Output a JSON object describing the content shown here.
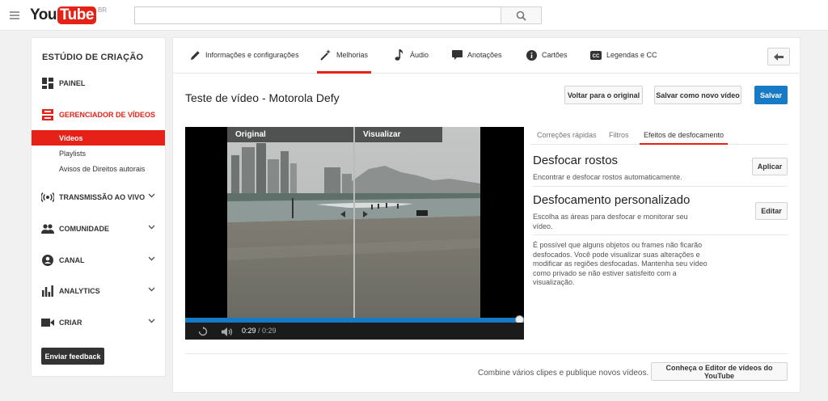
{
  "masthead": {
    "logo_you": "You",
    "logo_tube": "Tube",
    "logo_region": "BR",
    "search_placeholder": "",
    "icons": {
      "menu": "menu-icon",
      "search": "search-icon"
    }
  },
  "sidebar": {
    "heading": "ESTÚDIO DE CRIAÇÃO",
    "items": [
      {
        "label": "PAINEL",
        "icon": "dashboard-icon"
      },
      {
        "label": "GERENCIADOR DE VÍDEOS",
        "icon": "video-manager-icon",
        "active": true
      },
      {
        "label": "TRANSMISSÃO AO VIVO",
        "icon": "live-icon"
      },
      {
        "label": "COMUNIDADE",
        "icon": "community-icon"
      },
      {
        "label": "CANAL",
        "icon": "channel-icon"
      },
      {
        "label": "ANALYTICS",
        "icon": "analytics-icon"
      },
      {
        "label": "CRIAR",
        "icon": "create-icon"
      }
    ],
    "subitems": [
      {
        "label": "Vídeos",
        "active": true
      },
      {
        "label": "Playlists"
      },
      {
        "label": "Avisos de Direitos autorais"
      }
    ],
    "feedback_button": "Enviar feedback"
  },
  "tabs": [
    {
      "label": "Informações e configurações",
      "icon": "pencil-icon"
    },
    {
      "label": "Melhorias",
      "icon": "magic-wand-icon",
      "active": true
    },
    {
      "label": "Áudio",
      "icon": "music-note-icon"
    },
    {
      "label": "Anotações",
      "icon": "speech-bubble-icon"
    },
    {
      "label": "Cartões",
      "icon": "info-circle-icon"
    },
    {
      "label": "Legendas e CC",
      "icon": "cc-icon"
    }
  ],
  "video": {
    "title": "Teste de vídeo - Motorola Defy",
    "buttons": {
      "revert": "Voltar para o original",
      "save_as_new": "Salvar como novo vídeo",
      "save": "Salvar"
    },
    "player": {
      "label_original": "Original",
      "label_preview": "Visualizar",
      "current_time": "0:29",
      "duration": "/ 0:29",
      "progress": 1.0
    }
  },
  "effects": {
    "tabs": [
      "Correções rápidas",
      "Filtros",
      "Efeitos de desfocamento"
    ],
    "active_tab": "Efeitos de desfocamento",
    "face_blur": {
      "title": "Desfocar rostos",
      "description": "Encontrar e desfocar rostos automaticamente.",
      "button": "Aplicar"
    },
    "custom_blur": {
      "title": "Desfocamento personalizado",
      "description": "Escolha as áreas para desfocar e monitorar seu vídeo.",
      "button": "Editar"
    },
    "note": "É possível que alguns objetos ou frames não ficarão desfocados. Você pode visualizar suas alterações e modificar as regiões desfocadas. Mantenha seu vídeo como privado se não estiver satisfeito com a visualização."
  },
  "footer": {
    "combine_text": "Combine vários clipes e publique novos vídeos.",
    "editor_button": "Conheça o Editor de vídeos do YouTube"
  },
  "colors": {
    "accent_red": "#e62117",
    "primary_blue": "#167ac6",
    "text": "#333333"
  }
}
